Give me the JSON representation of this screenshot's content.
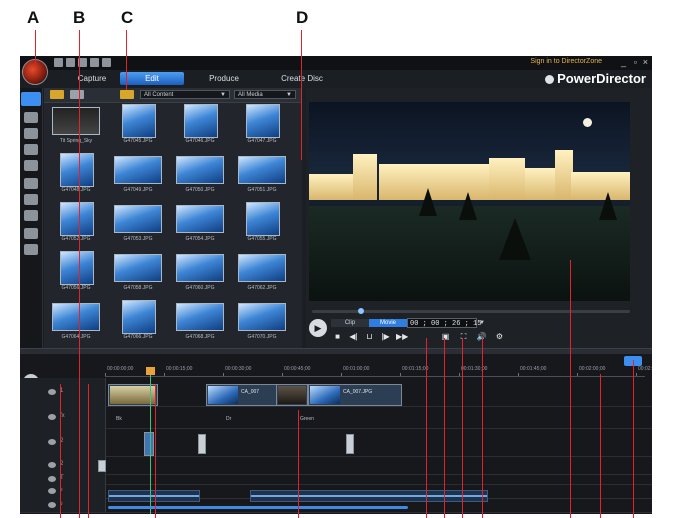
{
  "callouts": [
    "A",
    "B",
    "C",
    "D"
  ],
  "titlebar": {
    "signin": "Sign in to DirectorZone",
    "window_buttons": [
      "_",
      "▫",
      "×"
    ]
  },
  "tabs": [
    {
      "label": "Capture",
      "active": false
    },
    {
      "label": "Edit",
      "active": true
    },
    {
      "label": "Produce",
      "active": false
    },
    {
      "label": "Create Disc",
      "active": false
    }
  ],
  "brand": "PowerDirector",
  "library": {
    "filter_content": "All Content",
    "filter_media": "All Media",
    "thumbnails": [
      {
        "label": "Tit Spring_Sky",
        "kind": "wide"
      },
      {
        "label": "G47045.JPG",
        "kind": "tall"
      },
      {
        "label": "G47046.JPG",
        "kind": "tall"
      },
      {
        "label": "G47047.JPG",
        "kind": "tall"
      },
      {
        "label": "G47048.JPG",
        "kind": "tall"
      },
      {
        "label": "G47049.JPG",
        "kind": "wide"
      },
      {
        "label": "G47050.JPG",
        "kind": "wide"
      },
      {
        "label": "G47051.JPG",
        "kind": "wide"
      },
      {
        "label": "G47052.JPG",
        "kind": "tall"
      },
      {
        "label": "G47053.JPG",
        "kind": "wide"
      },
      {
        "label": "G47054.JPG",
        "kind": "wide"
      },
      {
        "label": "G47055.JPG",
        "kind": "tall"
      },
      {
        "label": "G47056.JPG",
        "kind": "tall"
      },
      {
        "label": "G47058.JPG",
        "kind": "wide"
      },
      {
        "label": "G47060.JPG",
        "kind": "wide"
      },
      {
        "label": "G47062.JPG",
        "kind": "wide"
      },
      {
        "label": "G47064.JPG",
        "kind": "wide"
      },
      {
        "label": "G47066.JPG",
        "kind": "tall"
      },
      {
        "label": "G47068.JPG",
        "kind": "wide"
      },
      {
        "label": "G47070.JPG",
        "kind": "wide"
      }
    ]
  },
  "preview": {
    "mode_clip": "Clip",
    "mode_movie": "Movie",
    "timecode": "00 ; 00 ; 26 ; 15",
    "play_glyph": "▶",
    "controls": [
      "■",
      "◀|",
      "⊔",
      "|▶",
      "▶▶",
      "▣",
      "⛶",
      "🔊",
      "⚙"
    ]
  },
  "timeline": {
    "ruler": [
      "00:00:00;00",
      "00:00:15;00",
      "00:00:30;00",
      "00:00:45;00",
      "00:01:00;00",
      "00:01:15;00",
      "00:01:30;00",
      "00:01:45;00",
      "00:02:00;00",
      "00:02:15;00"
    ],
    "tracks": [
      {
        "num": "1"
      },
      {
        "num": "fx"
      },
      {
        "num": "2"
      },
      {
        "num": "2"
      },
      {
        "num": "T"
      },
      {
        "num": "♪"
      },
      {
        "num": "♪"
      }
    ],
    "clip_label_1": "CA_007",
    "clip_label_2": "CA_007.JPG",
    "fx_tags": [
      "Bk",
      "Dr",
      "Green"
    ]
  }
}
